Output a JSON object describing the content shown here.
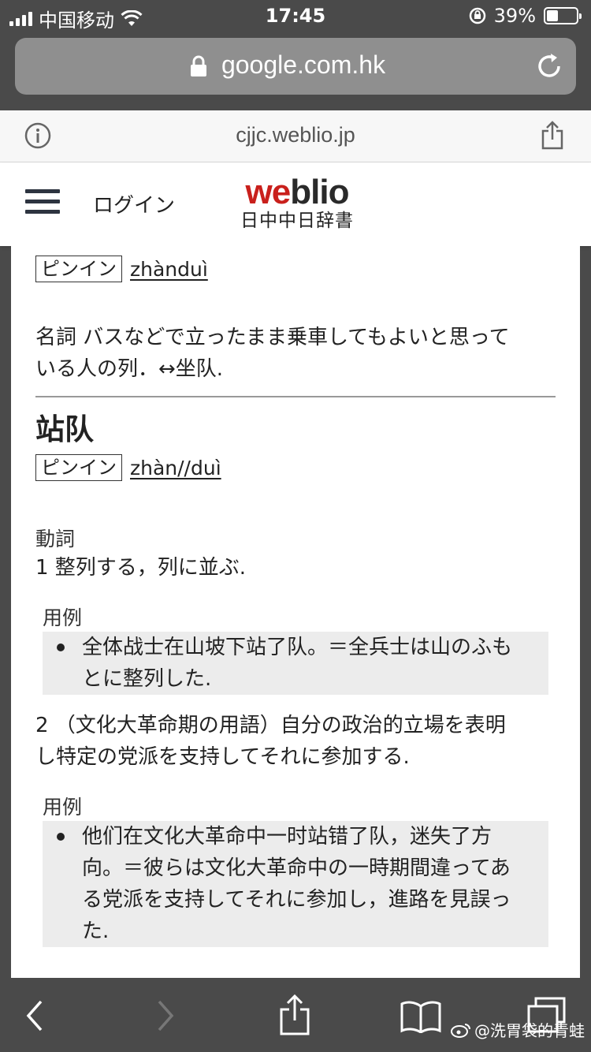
{
  "status_bar": {
    "carrier": "中国移动",
    "time": "17:45",
    "battery_percent_text": "39%",
    "battery_level": 0.39
  },
  "browser": {
    "url": "google.com.hk",
    "site_domain": "cjjc.weblio.jp"
  },
  "header": {
    "login_label": "ログイン",
    "logo_we": "we",
    "logo_blio": "blio",
    "logo_subtitle": "日中中日辞書"
  },
  "entry1": {
    "pinyin_label": "ピンイン",
    "pinyin": "zhànduì",
    "definition_line1": "名詞 バスなどで立ったまま乗車してもよいと思って",
    "definition_line2": "いる人の列．↔坐队."
  },
  "entry2": {
    "headword": "站队",
    "pinyin_label": "ピンイン",
    "pinyin": "zhàn//duì",
    "pos": "動詞",
    "sense1": "1 整列する，列に並ぶ.",
    "example_label_1": "用例",
    "example1_line1": "全体战士在山坡下站了队。＝全兵士は山のふも",
    "example1_line2": "とに整列した.",
    "sense2_line1": "2 （文化大革命期の用語）自分の政治的立場を表明",
    "sense2_line2": "し特定の党派を支持してそれに参加する.",
    "example_label_2": "用例",
    "example2_line1": "他们在文化大革命中一时站错了队，迷失了方",
    "example2_line2": "向。＝彼らは文化大革命中の一時期間違ってあ",
    "example2_line3": "る党派を支持してそれに参加し，進路を見誤っ",
    "example2_line4": "た."
  },
  "watermark": "@洗胃袋的青蛙",
  "icons": [
    "signal-icon",
    "wifi-icon",
    "rotation-lock-icon",
    "battery-icon",
    "lock-icon",
    "reload-icon",
    "info-icon",
    "share-icon",
    "hamburger-icon",
    "back-icon",
    "forward-icon",
    "bookmarks-icon",
    "tabs-icon"
  ]
}
